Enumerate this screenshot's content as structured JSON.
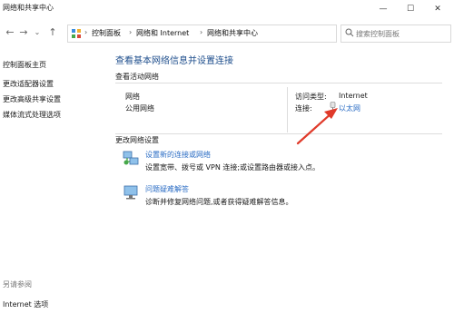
{
  "window": {
    "title": "网络和共享中心",
    "min_glyph": "—",
    "max_glyph": "☐",
    "close_glyph": "✕"
  },
  "nav": {
    "back_glyph": "←",
    "forward_glyph": "→",
    "recent_glyph": "⌄",
    "up_glyph": "↑"
  },
  "address": {
    "crumbs": [
      "控制面板",
      "网络和 Internet",
      "网络和共享中心"
    ],
    "separator": "›",
    "dropdown_glyph": "⌄",
    "refresh_glyph": "↻"
  },
  "search": {
    "placeholder": "搜索控制面板"
  },
  "sidebar": {
    "items": [
      {
        "label": "控制面板主页"
      },
      {
        "label": "更改适配器设置"
      },
      {
        "label": "更改高级共享设置"
      },
      {
        "label": "媒体流式处理选项"
      }
    ],
    "see_also": "另请参阅",
    "internet_options": "Internet 选项"
  },
  "main": {
    "title": "查看基本网络信息并设置连接",
    "active_section": "查看活动网络",
    "network_name": "网络",
    "network_type": "公用网络",
    "access_type_label": "访问类型:",
    "access_type_value": "Internet",
    "connections_label": "连接:",
    "connection_link": "以太网",
    "change_section": "更改网络设置",
    "new_conn_title": "设置新的连接或网络",
    "new_conn_desc": "设置宽带、拨号或 VPN 连接;或设置路由器或接入点。",
    "troubleshoot_title": "问题疑难解答",
    "troubleshoot_desc": "诊断并修复网络问题,或者获得疑难解答信息。"
  },
  "colors": {
    "accent": "#2a6cc4",
    "heading": "#1e4e8c",
    "annotation_arrow": "#e03a2a"
  }
}
